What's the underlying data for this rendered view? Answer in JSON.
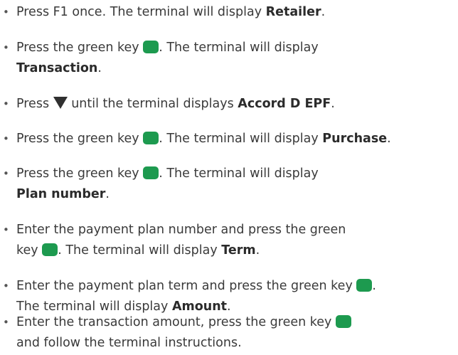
{
  "colors": {
    "green_key": "#1d9a4f",
    "arrow": "#303030",
    "text": "#3a3a3a"
  },
  "icons": {
    "green_key": "green-key-icon",
    "down_arrow": "down-triangle-icon"
  },
  "bullet": "•",
  "steps": [
    {
      "a": "Press F1 once. The terminal will display ",
      "b": "Retailer",
      "c": "."
    },
    {
      "a": "Press the green key ",
      "b": ". The terminal will display",
      "c": "Transaction",
      "d": "."
    },
    {
      "a": "Press ",
      "b": " until the terminal displays ",
      "c": "Accord D EPF",
      "d": "."
    },
    {
      "a": "Press the green key ",
      "b": ". The terminal will display ",
      "c": "Purchase",
      "d": "."
    },
    {
      "a": "Press the green key ",
      "b": ". The terminal will display",
      "c": "Plan number",
      "d": "."
    },
    {
      "a": "Enter the payment plan number and press the green",
      "b": "key ",
      "c": ". The terminal will display ",
      "d": "Term",
      "e": "."
    },
    {
      "a": "Enter the payment plan term and press the green key ",
      "b": ".",
      "c": "The terminal will display ",
      "d": "Amount",
      "e": "."
    },
    {
      "a": "Enter the transaction amount, press the green key ",
      "b": "and follow the terminal instructions."
    }
  ]
}
